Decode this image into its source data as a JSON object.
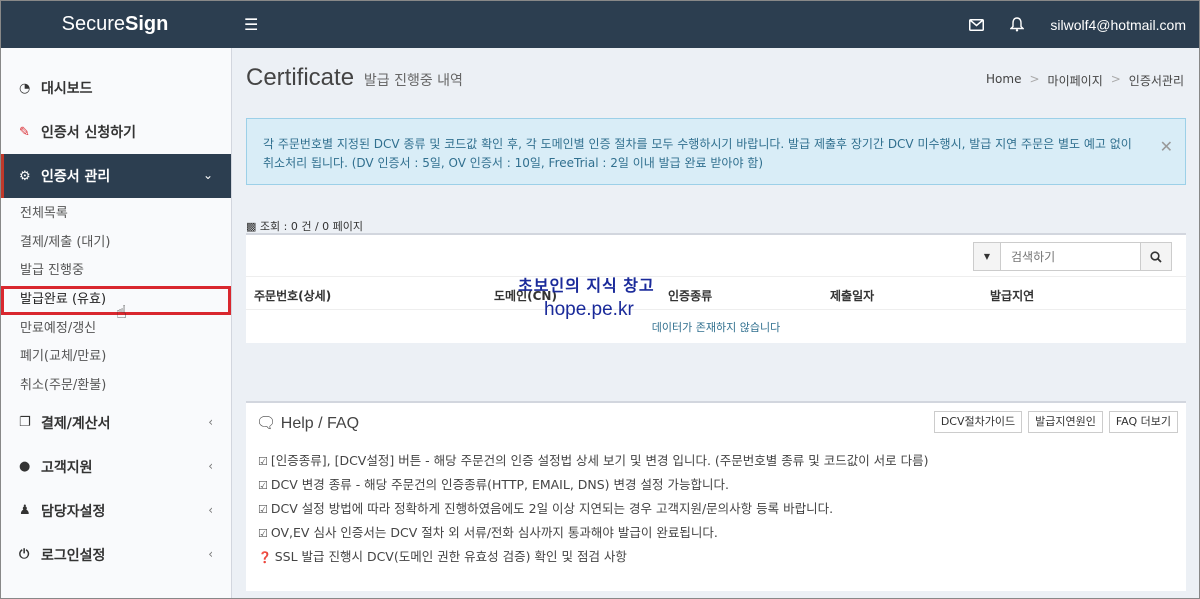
{
  "app": {
    "brand_light": "Secure",
    "brand_bold": "Sign",
    "user_email": "silwolf4@hotmail.com"
  },
  "sidebar": {
    "items": [
      {
        "icon": "dashboard-icon",
        "label": "대시보드"
      },
      {
        "icon": "edit-icon",
        "label": "인증서 신청하기"
      },
      {
        "icon": "gears-icon",
        "label": "인증서 관리"
      },
      {
        "icon": "file-icon",
        "label": "결제/계산서"
      },
      {
        "icon": "comments-icon",
        "label": "고객지원"
      },
      {
        "icon": "users-icon",
        "label": "담당자설정"
      },
      {
        "icon": "power-icon",
        "label": "로그인설정"
      }
    ],
    "sub_items": [
      "전체목록",
      "결제/제출 (대기)",
      "발급 진행중",
      "발급완료 (유효)",
      "만료예정/갱신",
      "폐기(교체/만료)",
      "취소(주문/환불)"
    ]
  },
  "header": {
    "title": "Certificate",
    "subtitle": "발급 진행중 내역"
  },
  "breadcrumb": [
    "Home",
    "마이페이지",
    "인증서관리"
  ],
  "alert": {
    "text": "각 주문번호별 지정된 DCV 종류 및 코드값 확인 후, 각 도메인별 인증 절차를 모두 수행하시기 바랍니다. 발급 제출후 장기간 DCV 미수행시, 발급 지연 주문은 별도 예고 없이 취소처리 됩니다. (DV 인증서 : 5일, OV 인증서 : 10일, FreeTrial : 2일 이내 발급 완료 받아야 함)"
  },
  "table": {
    "info": "조회 : 0 건 / 0 페이지",
    "search_placeholder": "검색하기",
    "columns": [
      "주문번호(상세)",
      "도메인(CN)",
      "인증종류",
      "제출일자",
      "발급지연"
    ],
    "empty_text": "데이터가 존재하지 않습니다"
  },
  "watermark": {
    "line1": "초보인의 지식 창고",
    "line2": "hope.pe.kr"
  },
  "help": {
    "title": "Help / FAQ",
    "buttons": [
      "DCV절차가이드",
      "발급지연원인",
      "FAQ 더보기"
    ],
    "lines": [
      "[인증종류], [DCV설정] 버튼 - 해당 주문건의 인증 설정법 상세 보기 및 변경 입니다. (주문번호별 종류 및 코드값이 서로 다름)",
      "DCV 변경 종류 - 해당 주문건의 인증종류(HTTP, EMAIL, DNS) 변경 설정 가능합니다.",
      "DCV 설정 방법에 따라 정확하게 진행하였음에도 2일 이상 지연되는 경우 고객지원/문의사항 등록 바랍니다.",
      "OV,EV 심사 인증서는 DCV 절차 외 서류/전화 심사까지 통과해야 발급이 완료됩니다.",
      "SSL 발급 진행시 DCV(도메인 권한 유효성 검증) 확인 및 점검 사항"
    ]
  }
}
